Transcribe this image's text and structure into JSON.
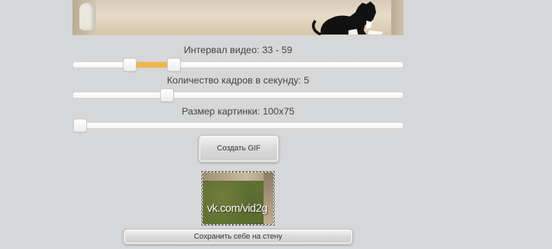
{
  "sliders": {
    "interval": {
      "label": "Интервал видео: 33 - 59",
      "value_min": 33,
      "value_max": 59,
      "range_color": "#f2b54a"
    },
    "fps": {
      "label": "Количество кадров в секунду: 5",
      "value": 5
    },
    "size": {
      "label": "Размер картинки: 100x75",
      "value": "100x75"
    }
  },
  "buttons": {
    "create_label": "Создать GIF",
    "save_label": "Сохранить себе на стену"
  },
  "preview": {
    "watermark": "vk.com/vid2g"
  },
  "colors": {
    "background": "#d6d7d8",
    "accent": "#f2b54a"
  }
}
